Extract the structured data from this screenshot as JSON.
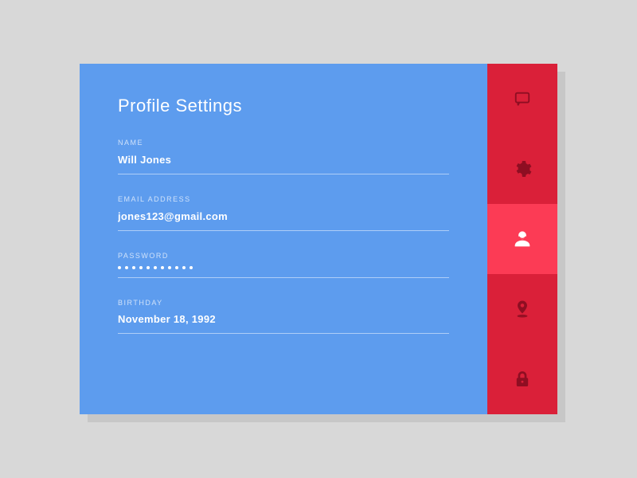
{
  "title": "Profile Settings",
  "fields": {
    "name": {
      "label": "NAME",
      "value": "Will Jones"
    },
    "email": {
      "label": "EMAIL ADDRESS",
      "value": "jones123@gmail.com"
    },
    "password": {
      "label": "PASSWORD",
      "value": "•••••••••••"
    },
    "birthday": {
      "label": "BIRTHDAY",
      "value": "November 18, 1992"
    }
  },
  "sidebar": {
    "items": [
      {
        "name": "chat",
        "icon": "chat-icon",
        "active": false
      },
      {
        "name": "settings",
        "icon": "gear-icon",
        "active": false
      },
      {
        "name": "profile",
        "icon": "user-icon",
        "active": true
      },
      {
        "name": "location",
        "icon": "location-icon",
        "active": false
      },
      {
        "name": "security",
        "icon": "lock-icon",
        "active": false
      }
    ]
  },
  "colors": {
    "panel_blue": "#5d9cee",
    "sidebar_red": "#da2039",
    "sidebar_active": "#fc3b55",
    "icon_dark": "#8e0e22"
  }
}
